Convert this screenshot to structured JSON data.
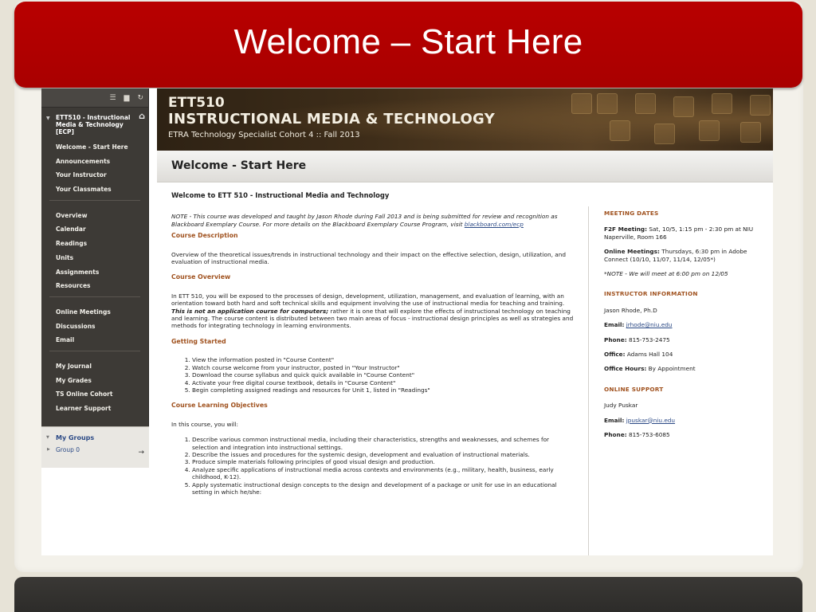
{
  "slide": {
    "title": "Welcome – Start Here"
  },
  "menu": {
    "top_icons": [
      "list-icon",
      "folder-icon",
      "refresh-icon"
    ],
    "course_title": "ETT510 - Instructional Media & Technology [ECP]",
    "group1": [
      "Welcome - Start Here",
      "Announcements",
      "Your Instructor",
      "Your Classmates"
    ],
    "group2": [
      "Overview",
      "Calendar",
      "Readings",
      "Units",
      "Assignments",
      "Resources"
    ],
    "group3": [
      "Online Meetings",
      "Discussions",
      "Email"
    ],
    "group4": [
      "My Journal",
      "My Grades",
      "TS Online Cohort",
      "Learner Support"
    ],
    "my_groups": "My Groups",
    "group_item": "Group 0"
  },
  "banner": {
    "code": "ETT510",
    "name": "INSTRUCTIONAL MEDIA & TECHNOLOGY",
    "sub": "ETRA Technology Specialist Cohort 4 :: Fall 2013"
  },
  "page": {
    "title": "Welcome - Start Here"
  },
  "main": {
    "heading": "Welcome to ETT 510 - Instructional Media and Technology",
    "note": "NOTE - This course was developed and taught by Jason Rhode during Fall 2013 and is being submitted for review and recognition as Blackboard Exemplary Course. For more details on the Blackboard Exemplary Course Program, visit",
    "note_link": "blackboard.com/ecp",
    "desc_heading": "Course Description",
    "desc_text": "Overview of the theoretical issues/trends in instructional technology and their impact on the effective selection, design, utilization, and evaluation of instructional media.",
    "overview_heading": "Course Overview",
    "overview_text_a": "In ETT 510, you will be exposed to the processes of design, development, utilization, management, and evaluation of learning, with an orientation toward both hard and soft technical skills and equipment involving the use of instructional media for teaching and training.",
    "overview_text_b": "This is not an application course for computers;",
    "overview_text_c": "rather it is one that will explore the effects of instructional technology on teaching and learning. The course content is distributed between two main areas of focus - instructional design principles as well as strategies and methods for integrating technology in learning environments.",
    "gs_heading": "Getting Started",
    "gs_items": [
      "View the information posted in \"Course Content\"",
      "Watch course welcome from your instructor, posted in \"Your Instructor\"",
      "Download the course syllabus and quick quick available in \"Course Content\"",
      "Activate your free digital course textbook, details in \"Course Content\"",
      "Begin completing assigned readings and resources for Unit 1, listed in \"Readings\""
    ],
    "obj_heading": "Course Learning Objectives",
    "obj_intro": "In this course, you will:",
    "obj_items": [
      "Describe various common instructional media, including their characteristics, strengths and weaknesses, and schemes for selection and integration into instructional settings.",
      "Describe the issues and procedures for the systemic design, development and evaluation of instructional materials.",
      "Produce simple materials following principles of good visual design and production.",
      "Analyze specific applications of instructional media across contexts and environments (e.g., military, health, business, early childhood, K-12).",
      "Apply systematic instructional design concepts to the design and development of a package or unit for use in an educational setting in which he/she:"
    ]
  },
  "side": {
    "meet_heading": "MEETING DATES",
    "f2f_label": "F2F Meeting:",
    "f2f_text": "Sat, 10/5, 1:15 pm - 2:30 pm at NIU Naperville, Room 166",
    "online_label": "Online Meetings:",
    "online_text": "Thursdays, 6:30 pm in Adobe Connect (10/10, 11/07, 11/14, 12/05*)",
    "note": "*NOTE - We will meet at 6:00 pm on 12/05",
    "inst_heading": "INSTRUCTOR INFORMATION",
    "inst_name": "Jason Rhode, Ph.D",
    "email_label": "Email:",
    "inst_email": "jrhode@niu.edu",
    "phone_label": "Phone:",
    "inst_phone": "815-753-2475",
    "office_label": "Office:",
    "inst_office": "Adams Hall 104",
    "hours_label": "Office Hours:",
    "inst_hours": "By Appointment",
    "support_heading": "ONLINE SUPPORT",
    "support_name": "Judy Puskar",
    "support_email": "jpuskar@niu.edu",
    "support_phone": "815-753-6085"
  }
}
